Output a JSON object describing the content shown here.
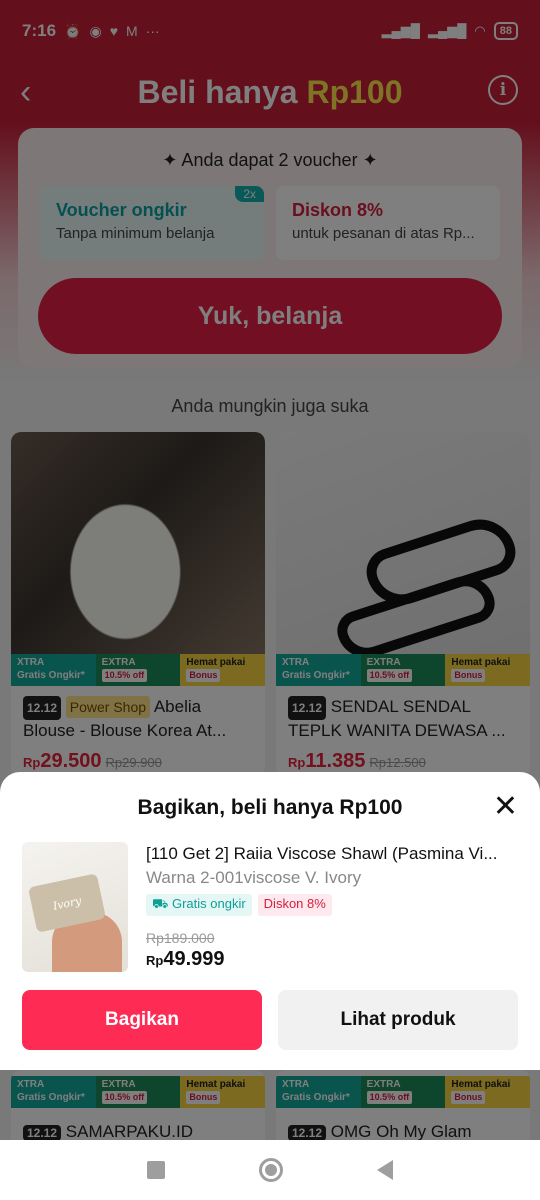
{
  "status_bar": {
    "time": "7:16",
    "battery": "88",
    "icons": [
      "alarm-icon",
      "whatsapp-icon",
      "lazada-icon",
      "gmail-icon",
      "more-icon",
      "signal-icon",
      "signal-icon",
      "wifi-icon",
      "battery-icon"
    ]
  },
  "header": {
    "title_prefix": "Beli hanya ",
    "title_accent": "Rp100"
  },
  "voucher": {
    "heading": "✦ Anda dapat 2 voucher ✦",
    "items": [
      {
        "title": "Voucher ongkir",
        "subtitle": "Tanpa minimum belanja",
        "badge": "2x"
      },
      {
        "title": "Diskon 8%",
        "subtitle": "untuk pesanan di atas Rp..."
      }
    ],
    "cta": "Yuk, belanja"
  },
  "recommend": {
    "title": "Anda mungkin juga suka",
    "products": [
      {
        "tag": "12.12",
        "shop_tag": "Power Shop",
        "title": "Abelia Blouse - Blouse Korea At...",
        "price_prefix": "Rp",
        "price": "29.500",
        "old_price": "Rp29.900",
        "promo": {
          "xtra": "XTRA",
          "xtra_sub": "Gratis Ongkir*",
          "extra": "EXTRA",
          "extra_sub": "10.5% off",
          "hemat": "Hemat pakai",
          "hemat_sub": "Bonus"
        }
      },
      {
        "tag": "12.12",
        "title": "SENDAL SENDAL TEPLK WANITA DEWASA ...",
        "price_prefix": "Rp",
        "price": "11.385",
        "old_price": "Rp12.500",
        "promo": {
          "xtra": "XTRA",
          "xtra_sub": "Gratis Ongkir*",
          "extra": "EXTRA",
          "extra_sub": "10.5% off",
          "hemat": "Hemat pakai",
          "hemat_sub": "Bonus"
        }
      }
    ],
    "lower": [
      {
        "tag": "12.12",
        "title": "SAMARPAKU.ID"
      },
      {
        "tag": "12.12",
        "title": "OMG Oh My Glam"
      }
    ]
  },
  "sheet": {
    "title": "Bagikan, beli hanya Rp100",
    "product_name": "[110 Get 2] Raiia Viscose Shawl (Pasmina Vi...",
    "variant": "Warna 2-001viscose V. Ivory",
    "chip_shipping": "Gratis ongkir",
    "chip_discount": "Diskon 8%",
    "old_price": "Rp189.000",
    "price_prefix": "Rp",
    "price": "49.999",
    "thumb_label": "Ivory",
    "share_button": "Bagikan",
    "view_button": "Lihat produk"
  }
}
